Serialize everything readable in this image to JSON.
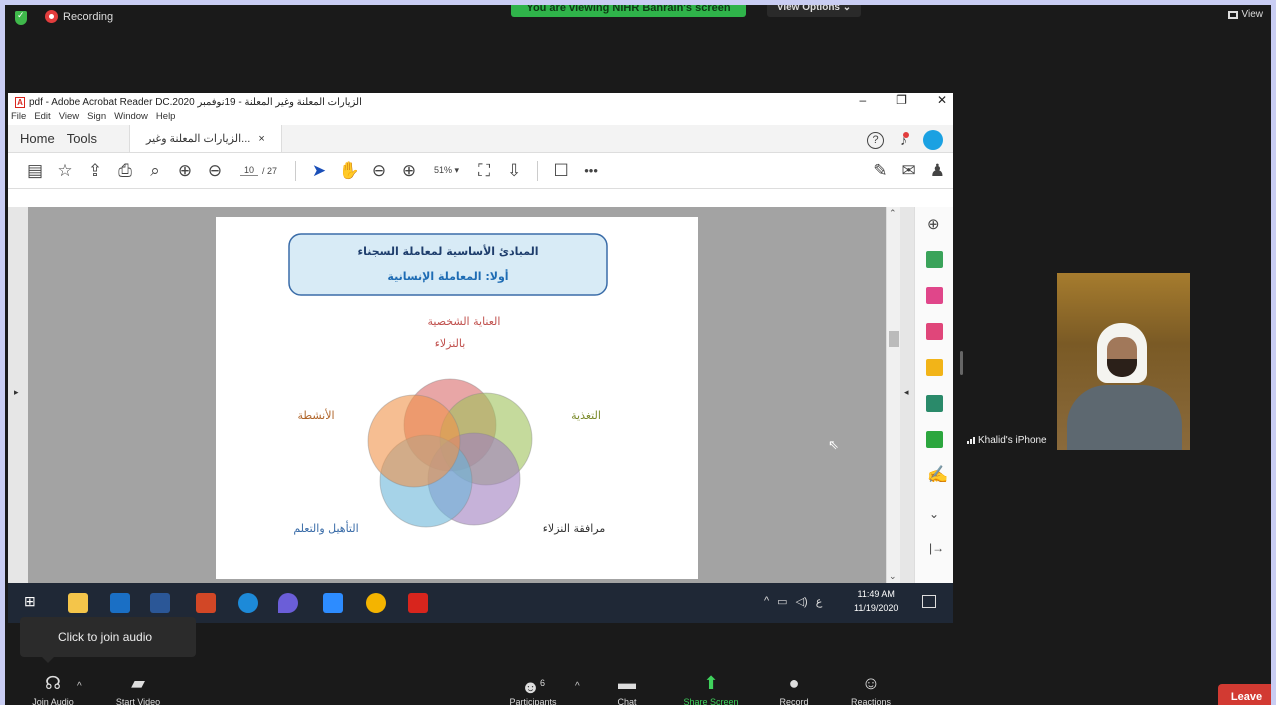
{
  "zoom": {
    "recording_label": "Recording",
    "viewing_banner": "You are viewing NIHR Bahrain's screen",
    "view_options_label": "View Options",
    "view_label": "View",
    "tooltip": "Click to join audio",
    "participant_name": "Khalid's iPhone",
    "participants_count": "6",
    "controls": {
      "join_audio": "Join Audio",
      "start_video": "Start Video",
      "participants": "Participants",
      "chat": "Chat",
      "share_screen": "Share Screen",
      "record": "Record",
      "reactions": "Reactions",
      "leave": "Leave"
    }
  },
  "acrobat": {
    "window_title": "الزيارات المعلنة وغير المعلنة - 19نوفمبر 2020.pdf - Adobe Acrobat Reader DC",
    "menu": [
      "File",
      "Edit",
      "View",
      "Sign",
      "Window",
      "Help"
    ],
    "home_tab": "Home",
    "tools_tab": "Tools",
    "doc_tab": "الزيارات المعلنة وغير...",
    "page_current": "10",
    "page_total": "/ 27",
    "zoom": "51%"
  },
  "slide": {
    "title_line1": "المبادئ الأساسية لمعاملة السجناء",
    "title_line2": "أولا: المعاملة الإنسانية",
    "top_label_line1": "العناية الشخصية",
    "top_label_line2": "بالنزلاء",
    "right_label": "التغذية",
    "left_label": "الأنشطة",
    "bottom_right_label": "مرافقة النزلاء",
    "bottom_left_label": "التأهيل والتعلم",
    "circle_colors": [
      "#d96b6b",
      "#9ec25a",
      "#a07fc0",
      "#6ab6d8",
      "#f0924a"
    ]
  },
  "taskbar": {
    "language": "ع",
    "time": "11:49 AM",
    "date": "11/19/2020"
  }
}
